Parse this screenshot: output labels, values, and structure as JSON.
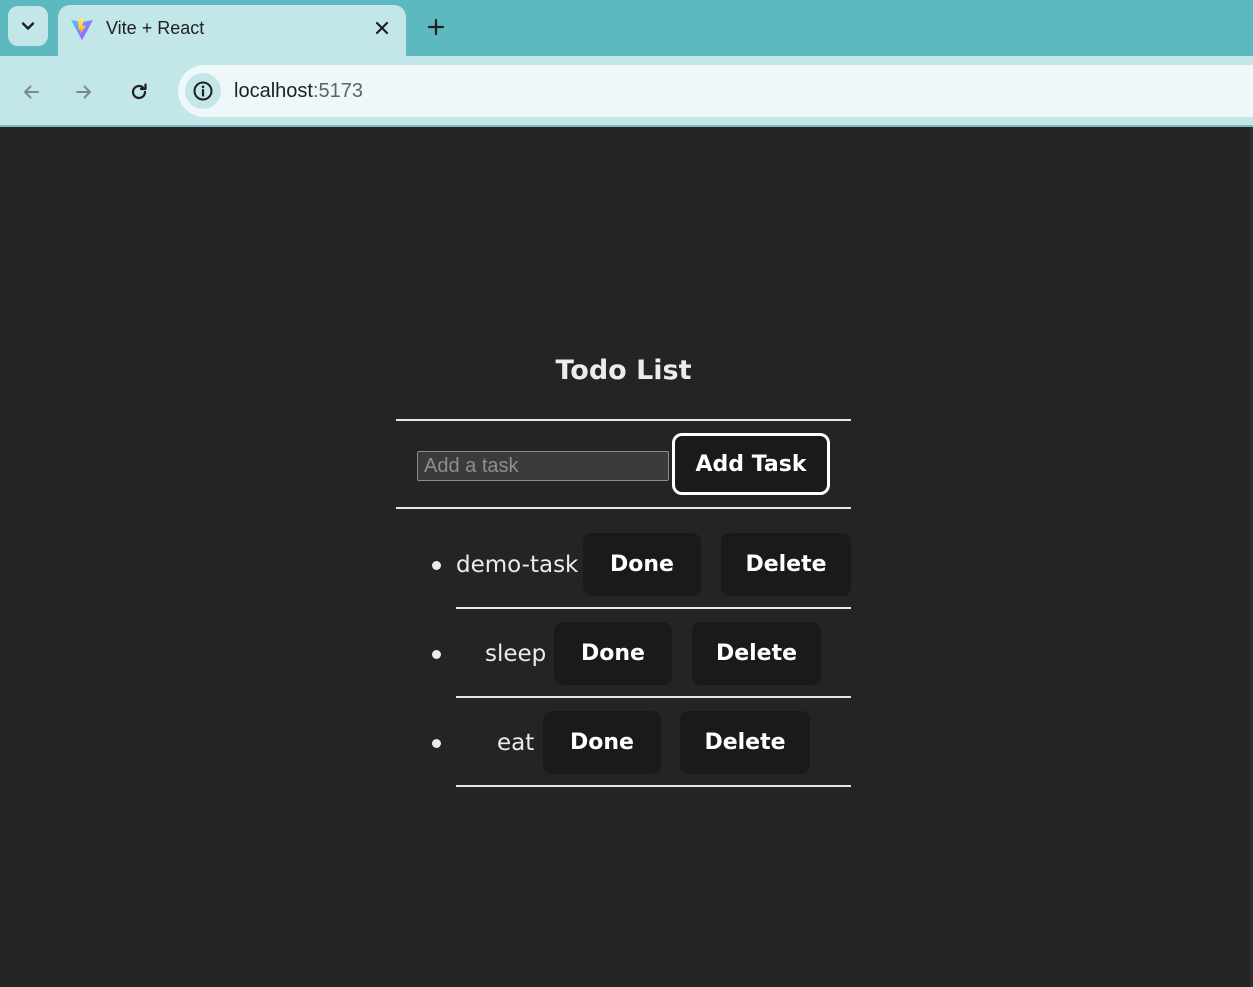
{
  "browser": {
    "tab_title": "Vite + React",
    "url_host": "localhost",
    "url_port": ":5173",
    "icons": {
      "tab_search": "chevron-down-icon",
      "favicon": "vite-logo-icon",
      "tab_close": "close-icon",
      "new_tab": "plus-icon",
      "back": "arrow-left-icon",
      "forward": "arrow-right-icon",
      "reload": "reload-icon",
      "site_info": "info-icon"
    }
  },
  "app": {
    "title": "Todo List",
    "input_placeholder": "Add a task",
    "input_value": "",
    "add_button": "Add Task",
    "tasks": [
      {
        "name": "demo-task",
        "done_label": "Done",
        "delete_label": "Delete"
      },
      {
        "name": "sleep",
        "done_label": "Done",
        "delete_label": "Delete"
      },
      {
        "name": "eat",
        "done_label": "Done",
        "delete_label": "Delete"
      }
    ]
  },
  "colors": {
    "tabstrip": "#5cb9c0",
    "toolbar": "#c3e6e9",
    "page_background": "#242424",
    "button_background": "#1a1a1a",
    "text": "#ececec"
  }
}
